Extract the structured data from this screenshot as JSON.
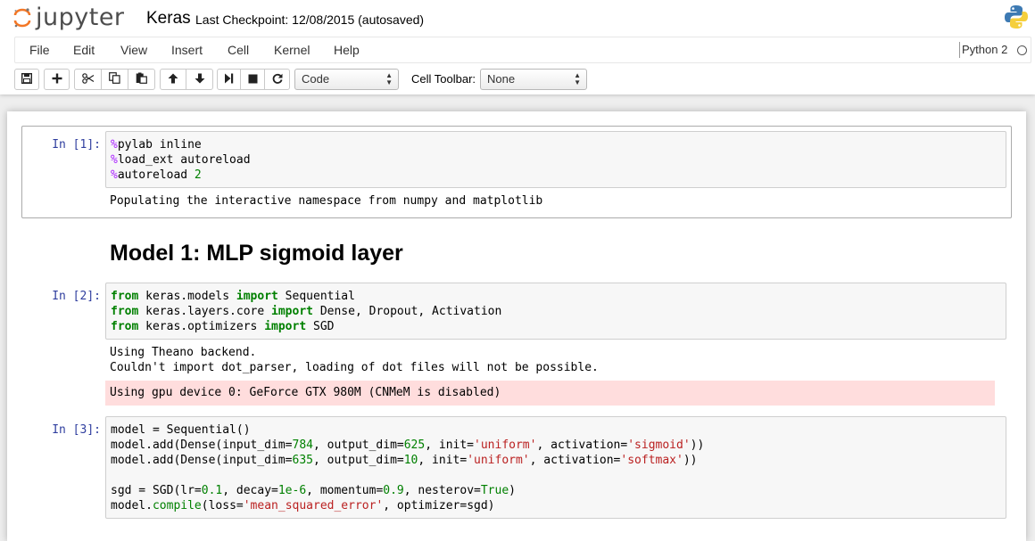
{
  "header": {
    "logo_text": "jupyter",
    "notebook_name": "Keras",
    "checkpoint": "Last Checkpoint: 12/08/2015 (autosaved)"
  },
  "menu": [
    "File",
    "Edit",
    "View",
    "Insert",
    "Cell",
    "Kernel",
    "Help"
  ],
  "kernel": {
    "name": "Python 2"
  },
  "toolbar": {
    "cell_type": "Code",
    "cell_toolbar_label": "Cell Toolbar:",
    "cell_toolbar_value": "None"
  },
  "cells": [
    {
      "prompt": "In [1]:",
      "code": [
        "%pylab inline",
        "%load_ext autoreload",
        "%autoreload 2"
      ],
      "output": [
        "Populating the interactive namespace from numpy and matplotlib"
      ]
    },
    {
      "markdown_heading": "Model 1: MLP sigmoid layer"
    },
    {
      "prompt": "In [2]:",
      "code": [
        "from keras.models import Sequential",
        "from keras.layers.core import Dense, Dropout, Activation",
        "from keras.optimizers import SGD"
      ],
      "output": [
        "Using Theano backend.",
        "Couldn't import dot_parser, loading of dot files will not be possible."
      ],
      "stderr": "Using gpu device 0: GeForce GTX 980M (CNMeM is disabled)"
    },
    {
      "prompt": "In [3]:",
      "code": [
        "model = Sequential()",
        "model.add(Dense(input_dim=784, output_dim=625, init='uniform', activation='sigmoid'))",
        "model.add(Dense(input_dim=635, output_dim=10, init='uniform', activation='softmax'))",
        "",
        "sgd = SGD(lr=0.1, decay=1e-6, momentum=0.9, nesterov=True)",
        "model.compile(loss='mean_squared_error', optimizer=sgd)"
      ]
    }
  ]
}
